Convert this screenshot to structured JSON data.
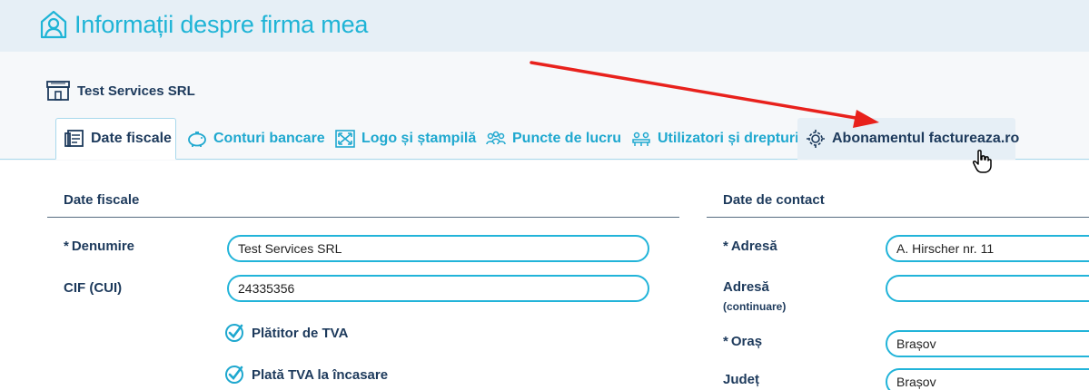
{
  "header": {
    "title": "Informații despre firma mea",
    "title_icon": "user-profile-icon"
  },
  "company": {
    "name": "Test Services SRL",
    "icon": "shop-icon"
  },
  "tabs": [
    {
      "label": "Date fiscale",
      "icon": "document-icon",
      "active": true
    },
    {
      "label": "Conturi bancare",
      "icon": "piggy-bank-icon"
    },
    {
      "label": "Logo și ștampilă",
      "icon": "expand-image-icon"
    },
    {
      "label": "Puncte de lucru",
      "icon": "people-group-icon"
    },
    {
      "label": "Utilizatori și drepturi",
      "icon": "users-table-icon"
    },
    {
      "label": "Abonamentul factureaza.ro",
      "icon": "gear-icon",
      "hovered": true
    }
  ],
  "fiscal": {
    "section_title": "Date fiscale",
    "name_label": "Denumire",
    "name_value": "Test Services SRL",
    "cif_label": "CIF (CUI)",
    "cif_value": "24335356",
    "vat_payer_label": "Plătitor de TVA",
    "vat_cash_label": "Plată TVA la încasare",
    "required_mark": "*"
  },
  "contact": {
    "section_title": "Date de contact",
    "address_label": "Adresă",
    "address_value": "A. Hirscher nr. 11",
    "address2_label": "Adresă",
    "address2_sublabel": "(continuare)",
    "address2_value": "",
    "city_label": "Oraș",
    "city_value": "Brașov",
    "county_label": "Județ",
    "county_value": "Brașov",
    "required_mark": "*"
  },
  "colors": {
    "accent": "#1fb4d6",
    "text": "#1d3a5c",
    "arrow": "#e8211c",
    "header_bg": "#e6eff6"
  }
}
